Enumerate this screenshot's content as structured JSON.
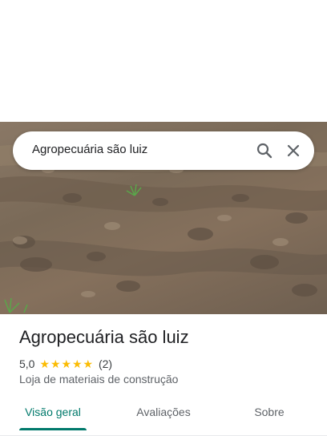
{
  "search": {
    "query": "Agropecuária são luiz"
  },
  "place": {
    "name": "Agropecuária são luiz",
    "rating": "5,0",
    "stars": 5,
    "review_count": "(2)",
    "category": "Loja de materiais de construção"
  },
  "tabs": [
    {
      "label": "Visão geral",
      "active": true
    },
    {
      "label": "Avaliações",
      "active": false
    },
    {
      "label": "Sobre",
      "active": false
    }
  ],
  "icons": {
    "search": "search-icon",
    "close": "close-icon",
    "star": "star-icon"
  },
  "colors": {
    "accent": "#00796b",
    "star": "#fbbc04",
    "text": "#202124",
    "secondary_text": "#5f6368"
  }
}
